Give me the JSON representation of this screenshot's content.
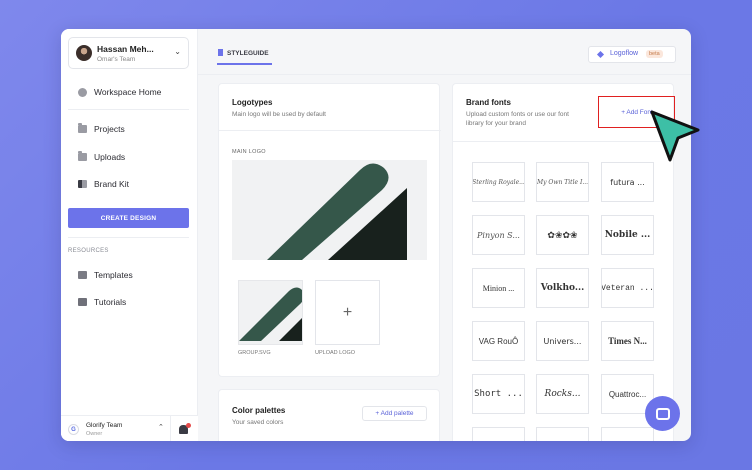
{
  "sidebar": {
    "user": {
      "name": "Hassan Meh...",
      "team": "Omar's Team"
    },
    "workspace_home": "Workspace Home",
    "items": [
      {
        "label": "Projects"
      },
      {
        "label": "Uploads"
      },
      {
        "label": "Brand Kit"
      }
    ],
    "create_button": "CREATE DESIGN",
    "resources_heading": "RESOURCES",
    "resources": [
      {
        "label": "Templates"
      },
      {
        "label": "Tutorials"
      }
    ],
    "team_card": {
      "name": "Glorify Team",
      "role": "Owner",
      "icon": "G"
    }
  },
  "header": {
    "tab": "STYLEGUIDE",
    "logoflow_label": "Logoflow",
    "beta_badge": "beta"
  },
  "logotypes": {
    "title": "Logotypes",
    "subtitle": "Main logo will be used by default",
    "main_logo_label": "MAIN LOGO",
    "group_label": "GROUP.SVG",
    "upload_label": "UPLOAD LOGO"
  },
  "palettes": {
    "title": "Color palettes",
    "subtitle": "Your saved colors",
    "add_label": "+ Add palette"
  },
  "brand_fonts": {
    "title": "Brand fonts",
    "subtitle_line1": "Upload custom fonts or use our font",
    "subtitle_line2": "library for your brand",
    "add_label": "+ Add Font",
    "fonts": [
      "Sterling Royale...",
      "My Own Title I...",
      "futura ...",
      "Pinyon S...",
      "✿❀✿❀",
      "Nobile ...",
      "Minion ...",
      "Volkho...",
      "Veteran ...",
      "VAG RouÔ",
      "Univers...",
      "Times N...",
      "Short ...",
      "Rocks...",
      "Quattroc..."
    ]
  },
  "colors": {
    "accent": "#6c73ea",
    "logo_dark_green": "#35574a",
    "logo_black": "#18211d",
    "highlight_red": "#e02020",
    "cursor_teal": "#3dbfa6"
  }
}
